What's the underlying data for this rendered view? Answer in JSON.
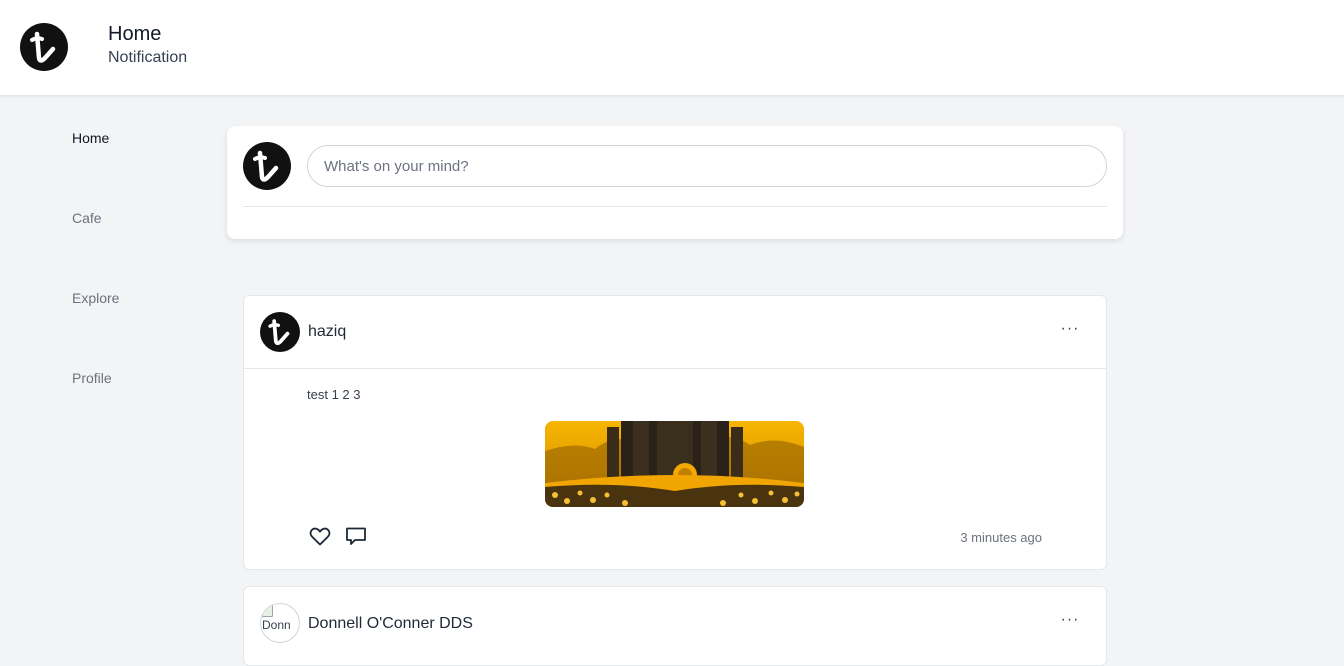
{
  "header": {
    "title": "Home",
    "subtitle": "Notification",
    "logo_icon": "t-brand-logo-icon"
  },
  "sidebar": {
    "items": [
      {
        "label": "Home",
        "active": true
      },
      {
        "label": "Cafe",
        "active": false
      },
      {
        "label": "Explore",
        "active": false
      },
      {
        "label": "Profile",
        "active": false
      }
    ]
  },
  "composer": {
    "placeholder": "What's on your mind?",
    "value": ""
  },
  "posts": [
    {
      "author": "haziq",
      "more_label": "···",
      "text": "test 1 2 3",
      "image_icon": "dark-fantasy-castle-sunflower-field-image",
      "like_icon": "heart-icon",
      "comment_icon": "comment-icon",
      "time": "3 minutes ago"
    },
    {
      "author": "Donnell O'Conner DDS",
      "avatar_alt": "Donn",
      "more_label": "···"
    }
  ],
  "colors": {
    "accent_image": "#f2a900",
    "page_bg": "#f3f4f6",
    "text_muted": "#6b7280"
  }
}
